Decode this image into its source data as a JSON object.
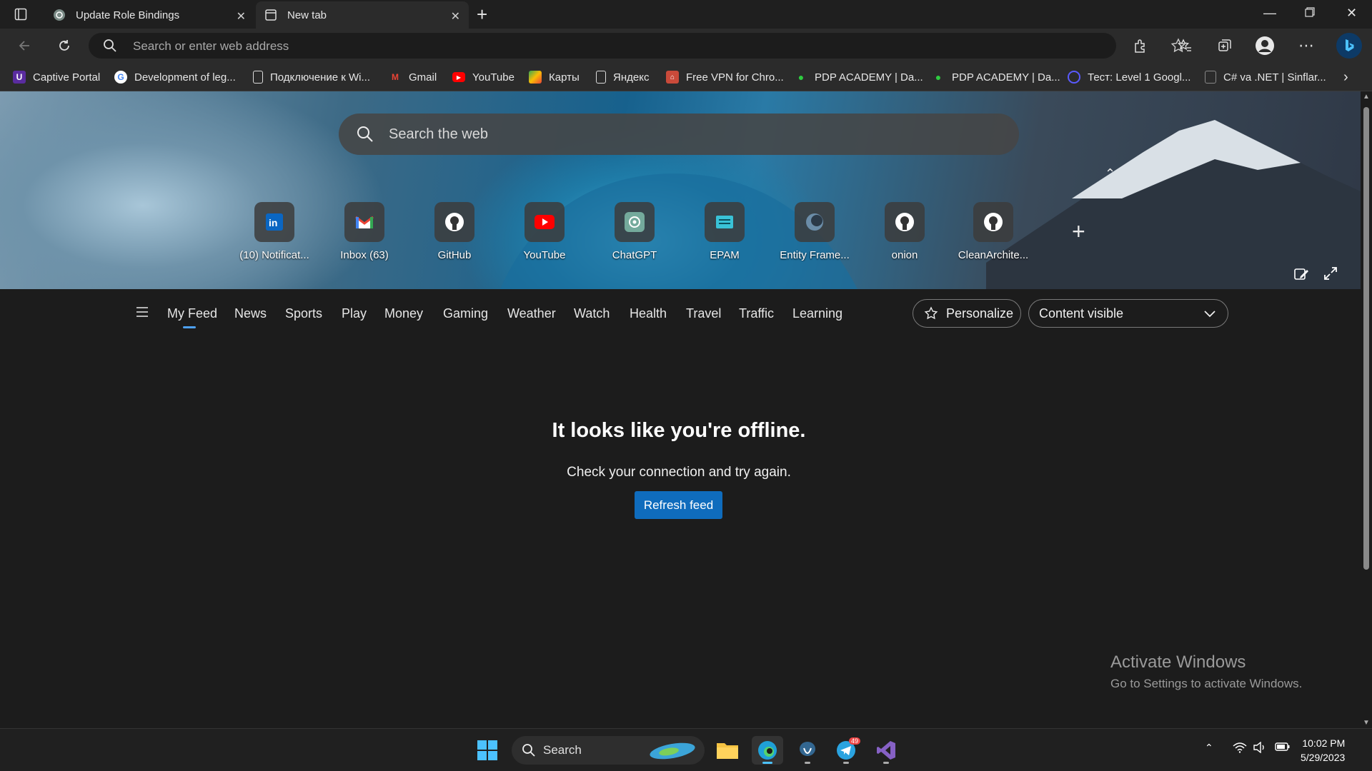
{
  "browser": {
    "tabs": [
      {
        "label": "Update Role Bindings",
        "active": false
      },
      {
        "label": "New tab",
        "active": true
      }
    ],
    "address_placeholder": "Search or enter web address"
  },
  "bookmarks": [
    {
      "label": "Captive Portal",
      "icon": "captive-portal-icon"
    },
    {
      "label": "Development of leg...",
      "icon": "google-icon"
    },
    {
      "label": "Подключение к Wi...",
      "icon": "page-icon"
    },
    {
      "label": "Gmail",
      "icon": "gmail-icon"
    },
    {
      "label": "YouTube",
      "icon": "youtube-icon"
    },
    {
      "label": "Карты",
      "icon": "maps-icon"
    },
    {
      "label": "Яндекс",
      "icon": "page-icon"
    },
    {
      "label": "Free VPN for Chro...",
      "icon": "vpn-icon"
    },
    {
      "label": "PDP ACADEMY | Da...",
      "icon": "pdp-icon"
    },
    {
      "label": "PDP ACADEMY | Da...",
      "icon": "pdp-icon"
    },
    {
      "label": "Тест: Level 1 Googl...",
      "icon": "quiz-icon"
    },
    {
      "label": "C# va .NET | Sinflar...",
      "icon": "page-icon"
    }
  ],
  "newtab": {
    "search_placeholder": "Search the web",
    "quick_links": [
      {
        "label": "(10) Notificat...",
        "icon": "linkedin-icon"
      },
      {
        "label": "Inbox (63)",
        "icon": "gmail-icon"
      },
      {
        "label": "GitHub",
        "icon": "github-icon"
      },
      {
        "label": "YouTube",
        "icon": "youtube-icon"
      },
      {
        "label": "ChatGPT",
        "icon": "chatgpt-icon"
      },
      {
        "label": "EPAM",
        "icon": "epam-icon"
      },
      {
        "label": "Entity Frame...",
        "icon": "entity-framework-icon"
      },
      {
        "label": "onion",
        "icon": "github-icon"
      },
      {
        "label": "CleanArchite...",
        "icon": "github-icon"
      }
    ]
  },
  "feed": {
    "nav": [
      "My Feed",
      "News",
      "Sports",
      "Play",
      "Money",
      "Gaming",
      "Weather",
      "Watch",
      "Health",
      "Travel",
      "Traffic",
      "Learning"
    ],
    "active": "My Feed",
    "personalize_label": "Personalize",
    "content_select": "Content visible"
  },
  "offline": {
    "heading": "It looks like you're offline.",
    "message": "Check your connection and try again.",
    "button": "Refresh feed"
  },
  "watermark": {
    "title": "Activate Windows",
    "subtitle": "Go to Settings to activate Windows."
  },
  "taskbar": {
    "search_label": "Search",
    "telegram_badge": "49",
    "time": "10:02 PM",
    "date": "5/29/2023"
  },
  "colors": {
    "accent": "#0f6cbd",
    "active_underline": "#4ea1f3"
  }
}
